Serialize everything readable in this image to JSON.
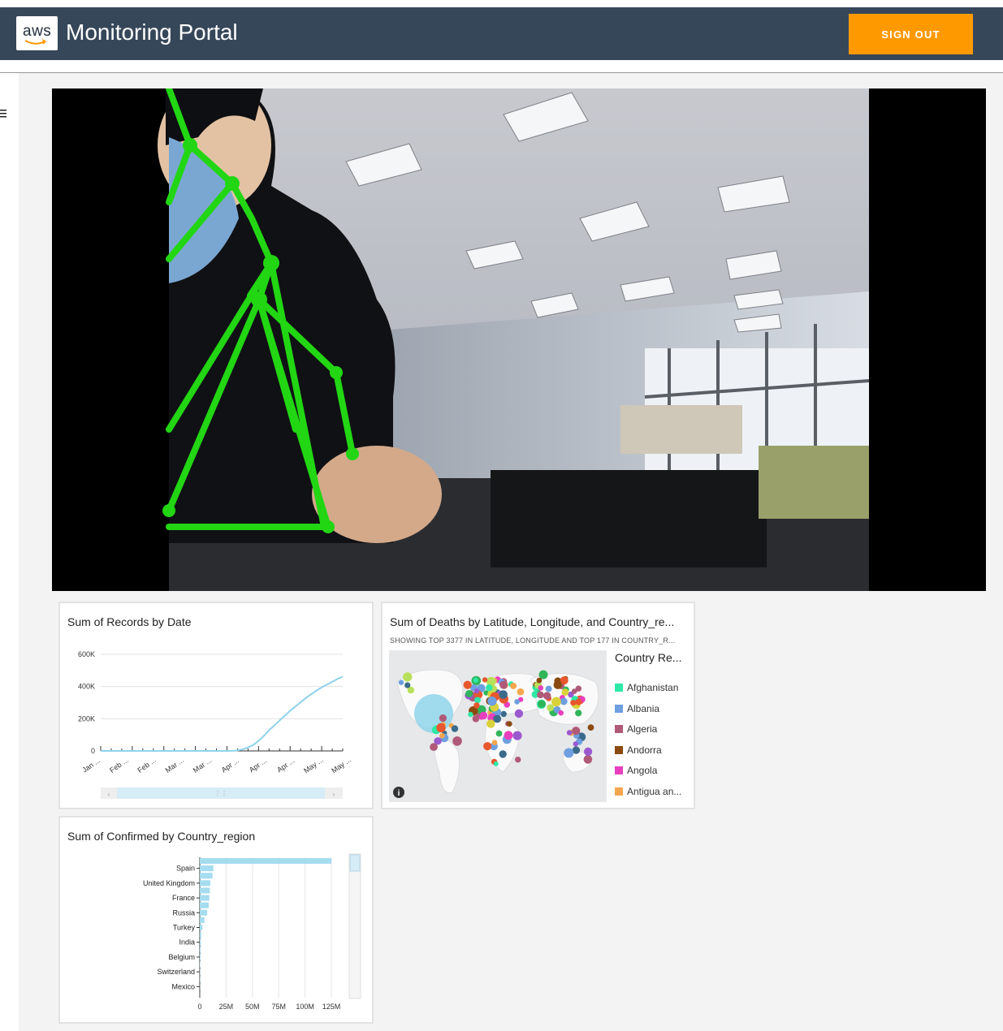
{
  "header": {
    "logo_text": "aws",
    "title": "Monitoring Portal",
    "sign_out_label": "SIGN OUT",
    "bg_color": "#37475a",
    "accent_color": "#ff9900"
  },
  "sidebar": {
    "menu_icon": "hamburger-menu-icon"
  },
  "video": {
    "description_icon": "camera-feed-with-pose-skeleton"
  },
  "line_card": {
    "title": "Sum of Records by Date",
    "chart_data": {
      "type": "line",
      "title": "Sum of Records by Date",
      "y_ticks": [
        "600K",
        "400K",
        "200K",
        "0"
      ],
      "ylim": [
        0,
        600000
      ],
      "x_ticks": [
        "Jan ...",
        "Feb ...",
        "Feb ...",
        "Mar ...",
        "Mar ...",
        "Apr ...",
        "Apr ...",
        "Apr ...",
        "May ...",
        "May ..."
      ],
      "series": [
        {
          "values": [
            0,
            0,
            0,
            0,
            0,
            0,
            0,
            0,
            0,
            0,
            0,
            0,
            0,
            0,
            0,
            0,
            0,
            0,
            0,
            0,
            0,
            0,
            0,
            0,
            0,
            0,
            0,
            0,
            0,
            0,
            0,
            0,
            0,
            0,
            0,
            0,
            0,
            0,
            0,
            0,
            0,
            0,
            0,
            0,
            0,
            0,
            0,
            500,
            1500,
            3000,
            6000,
            10000,
            15000,
            22000,
            30000,
            40000,
            52000,
            66000,
            82000,
            100000,
            118000,
            136000,
            152000,
            168000,
            184000,
            200000,
            216000,
            232000,
            248000,
            262000,
            276000,
            290000,
            304000,
            318000,
            332000,
            345000,
            356000,
            368000,
            380000,
            390000,
            400000,
            410000,
            418000,
            428000,
            436000,
            446000,
            454000,
            462000
          ],
          "color": "#8fd3ea"
        }
      ]
    }
  },
  "map_card": {
    "title": "Sum of Deaths by Latitude, Longitude, and Country_re...",
    "subtitle": "SHOWING TOP 3377 IN LATITUDE, LONGITUDE AND TOP 177 IN COUNTRY_R...",
    "legend_title": "Country Re...",
    "legend": [
      {
        "label": "Afghanistan",
        "color": "#2ee8a6"
      },
      {
        "label": "Albania",
        "color": "#6e9fe0"
      },
      {
        "label": "Algeria",
        "color": "#b05a78"
      },
      {
        "label": "Andorra",
        "color": "#8a4a10"
      },
      {
        "label": "Angola",
        "color": "#e83fbf"
      },
      {
        "label": "Antigua an...",
        "color": "#f5a64e"
      }
    ],
    "info_icon": "info-icon"
  },
  "bar_card": {
    "title": "Sum of Confirmed by Country_region",
    "chart_data": {
      "type": "bar",
      "orientation": "horizontal",
      "title": "Sum of Confirmed by Country_region",
      "categories": [
        "Spain",
        "United Kingdom",
        "France",
        "Russia",
        "Turkey",
        "India",
        "Belgium",
        "Switzerland",
        "Mexico"
      ],
      "category_labels_visible": [
        "Spain",
        "United Kingdom",
        "France",
        "Russia",
        "Turkey",
        "India",
        "Belgium",
        "Switzerland",
        "Mexico"
      ],
      "values": [
        125000000,
        13000000,
        12000000,
        10000000,
        9500000,
        9000000,
        8500000,
        7000000,
        4500000,
        2500000,
        1500000,
        1000000,
        800000,
        600000,
        400000,
        300000,
        200000,
        150000,
        100000
      ],
      "x_ticks": [
        "0",
        "25M",
        "50M",
        "75M",
        "100M",
        "125M"
      ],
      "xlim": [
        0,
        125000000
      ],
      "color": "#a6dcef"
    }
  }
}
